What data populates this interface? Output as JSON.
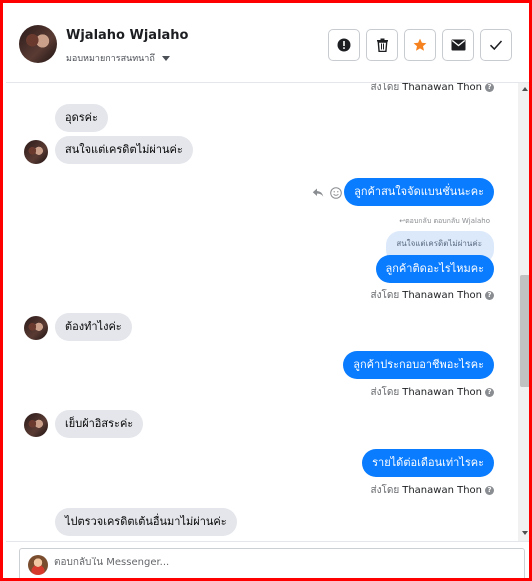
{
  "header": {
    "contact_name": "Wjalaho Wjalaho",
    "assign_label": "มอบหมายการสนทนาถึ",
    "actions": [
      {
        "name": "report-icon",
        "label": "report"
      },
      {
        "name": "trash-icon",
        "label": "delete"
      },
      {
        "name": "star-icon",
        "label": "star",
        "color": "#f5821f"
      },
      {
        "name": "envelope-icon",
        "label": "mark unread"
      },
      {
        "name": "check-icon",
        "label": "done"
      }
    ]
  },
  "thread": {
    "messages": [
      {
        "id": "m0",
        "sentby_prefix": "ส่งโดย",
        "sentby_name": "Thanawan Thon"
      },
      {
        "id": "m1",
        "side": "in",
        "text": "อุดรค่ะ"
      },
      {
        "id": "m2",
        "side": "in",
        "text": "สนใจแต่เครดิตไม่ผ่านค่ะ"
      },
      {
        "id": "m3",
        "side": "out",
        "text": "ลูกค้าสนใจจัดแบนชั่นนะคะ"
      },
      {
        "id": "m4",
        "side": "out",
        "reply_note": "↩ตอบกลับ ตอบกลับ Wjalaho",
        "quoted": "สนใจแต่เครดิตไม่ผ่านค่ะ",
        "text": "ลูกค้าติดอะไรไหมคะ",
        "sentby_prefix": "ส่งโดย",
        "sentby_name": "Thanawan Thon"
      },
      {
        "id": "m5",
        "side": "in",
        "text": "ต้องทำไงค่ะ"
      },
      {
        "id": "m6",
        "side": "out",
        "text": "ลูกค้าประกอบอาชีพอะไรคะ",
        "sentby_prefix": "ส่งโดย",
        "sentby_name": "Thanawan Thon"
      },
      {
        "id": "m7",
        "side": "in",
        "text": "เย็บผ้าอิสระค่ะ"
      },
      {
        "id": "m8",
        "side": "out",
        "text": "รายได้ต่อเดือนเท่าไรคะ",
        "sentby_prefix": "ส่งโดย",
        "sentby_name": "Thanawan Thon"
      },
      {
        "id": "m9",
        "side": "in",
        "text": "ไปตรวจเครดิตเต้นอื่นมาไม่ผ่านค่ะ"
      }
    ]
  },
  "composer": {
    "placeholder": "ตอบกลับใน Messenger..."
  },
  "colors": {
    "outgoing_bubble": "#0a7cff",
    "incoming_bubble": "#e4e6eb",
    "frame_border": "#ff0000"
  }
}
